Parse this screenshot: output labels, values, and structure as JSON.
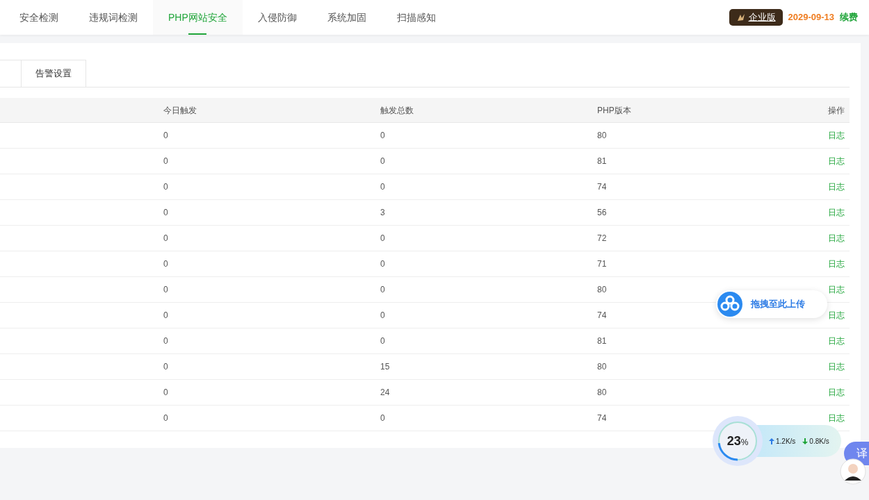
{
  "nav_tabs": [
    {
      "label": "安全检测",
      "selected": false
    },
    {
      "label": "违规词检测",
      "selected": false
    },
    {
      "label": "PHP网站安全",
      "selected": true
    },
    {
      "label": "入侵防御",
      "selected": false
    },
    {
      "label": "系统加固",
      "selected": false
    },
    {
      "label": "扫描感知",
      "selected": false
    }
  ],
  "edition": {
    "badge": "企业版",
    "expiry": "2029-09-13",
    "renew": "续费"
  },
  "sub_tabs": [
    {
      "label": "告警设置",
      "selected": false
    }
  ],
  "table": {
    "columns": [
      "今日触发",
      "触发总数",
      "PHP版本",
      "操作"
    ],
    "rows": [
      {
        "today": "0",
        "total": "0",
        "php": "80",
        "action": "日志"
      },
      {
        "today": "0",
        "total": "0",
        "php": "81",
        "action": "日志"
      },
      {
        "today": "0",
        "total": "0",
        "php": "74",
        "action": "日志"
      },
      {
        "today": "0",
        "total": "3",
        "php": "56",
        "action": "日志"
      },
      {
        "today": "0",
        "total": "0",
        "php": "72",
        "action": "日志"
      },
      {
        "today": "0",
        "total": "0",
        "php": "71",
        "action": "日志"
      },
      {
        "today": "0",
        "total": "0",
        "php": "80",
        "action": "日志"
      },
      {
        "today": "0",
        "total": "0",
        "php": "74",
        "action": "日志"
      },
      {
        "today": "0",
        "total": "0",
        "php": "81",
        "action": "日志"
      },
      {
        "today": "0",
        "total": "15",
        "php": "80",
        "action": "日志"
      },
      {
        "today": "0",
        "total": "24",
        "php": "80",
        "action": "日志"
      },
      {
        "today": "0",
        "total": "0",
        "php": "74",
        "action": "日志"
      }
    ]
  },
  "upload_bubble": {
    "label": "拖拽至此上传"
  },
  "speed_widget": {
    "percent": "23",
    "unit": "%",
    "level": 0.23,
    "upload": "1.2K/s",
    "download": "0.8K/s"
  },
  "translate_button": {
    "label": "译"
  }
}
